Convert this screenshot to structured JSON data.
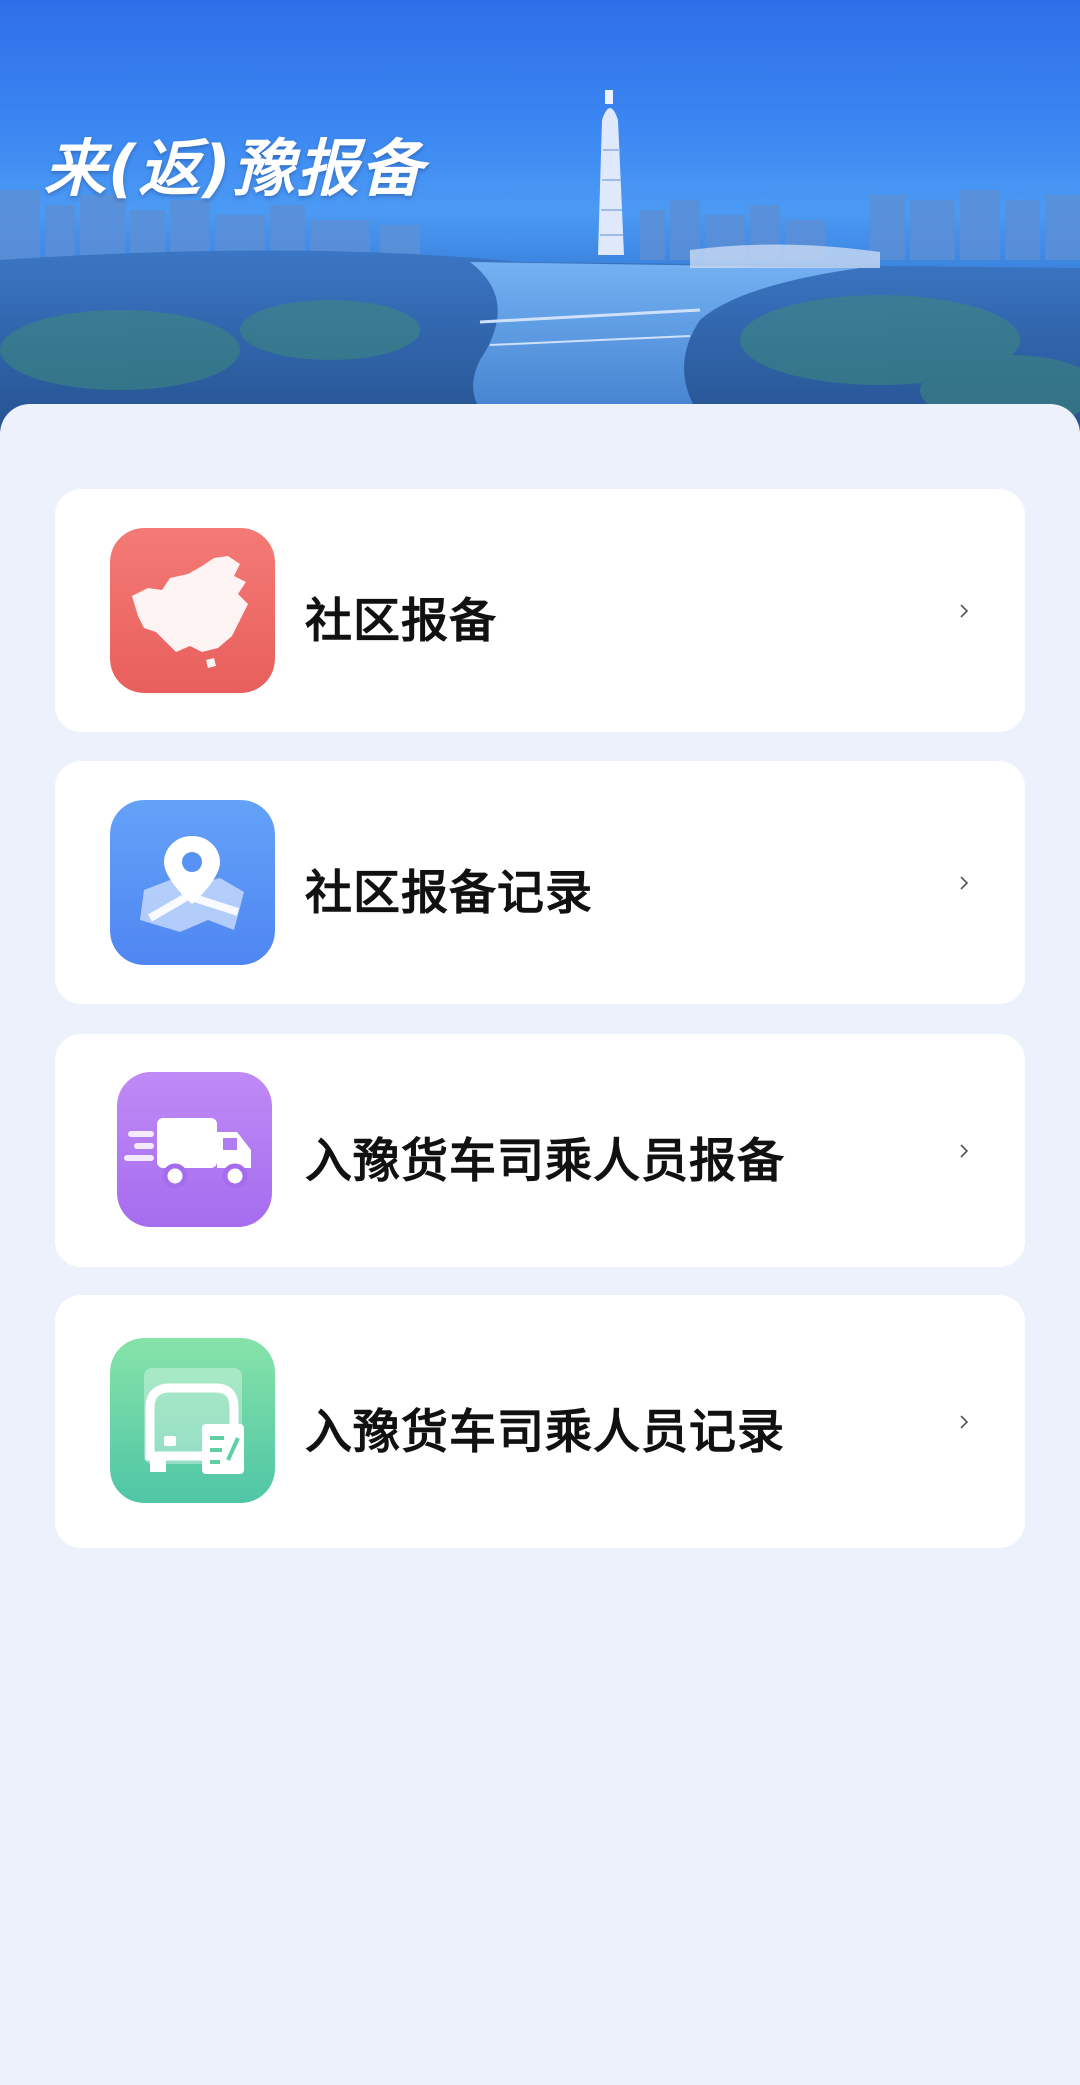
{
  "header": {
    "title": "来(返)豫报备"
  },
  "menu": {
    "items": [
      {
        "label": "社区报备",
        "icon": "china-map-icon",
        "color": "#ef6e6a"
      },
      {
        "label": "社区报备记录",
        "icon": "map-location-pin-icon",
        "color": "#5b98f7"
      },
      {
        "label": "入豫货车司乘人员报备",
        "icon": "delivery-truck-icon",
        "color": "#b67cf0"
      },
      {
        "label": "入豫货车司乘人员记录",
        "icon": "bus-record-icon",
        "color": "#5fd0a2"
      }
    ]
  }
}
